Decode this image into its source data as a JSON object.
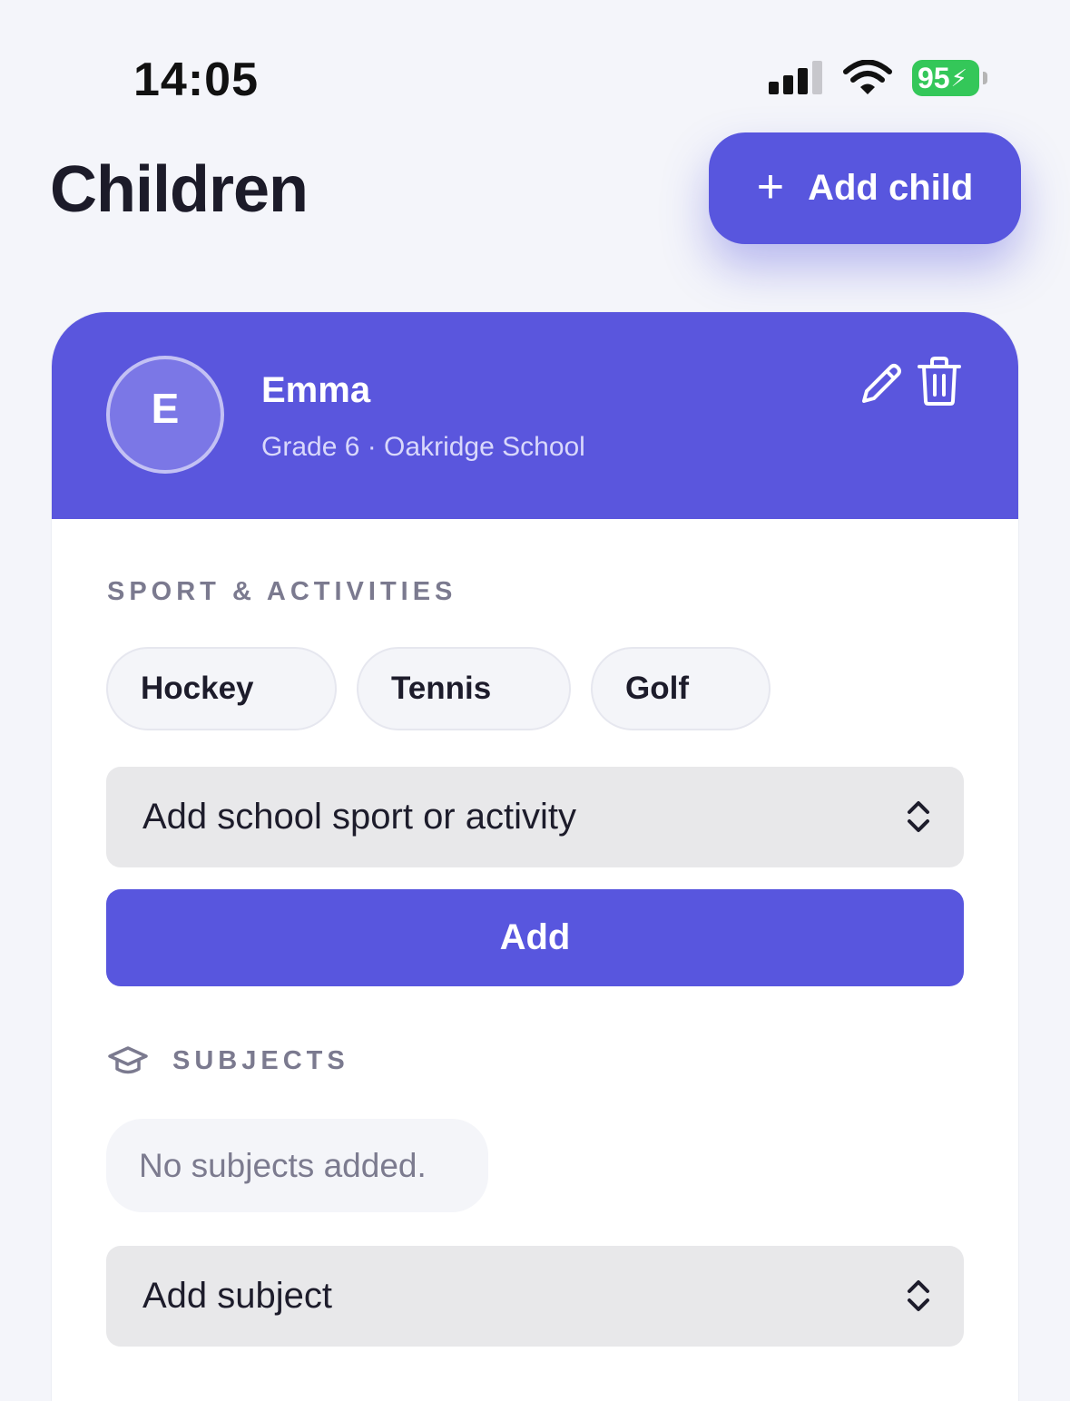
{
  "status_bar": {
    "time": "14:05",
    "battery": "95",
    "icons": [
      "cellular-signal-icon",
      "wifi-icon",
      "battery-charging-icon"
    ]
  },
  "header": {
    "title": "Children",
    "add_child_label": "Add child"
  },
  "child": {
    "initial": "E",
    "name": "Emma",
    "meta": "Grade 6 · Oakridge School"
  },
  "sports": {
    "label": "SPORT & ACTIVITIES",
    "items": [
      "Hockey",
      "Tennis",
      "Golf"
    ],
    "select_placeholder": "Add school sport or activity",
    "add_label": "Add"
  },
  "subjects": {
    "label": "SUBJECTS",
    "empty_text": "No subjects added.",
    "select_placeholder": "Add subject"
  },
  "colors": {
    "accent": "#5856de",
    "card_header": "#5a56dd",
    "battery": "#34c759",
    "background": "#f4f5fa"
  }
}
